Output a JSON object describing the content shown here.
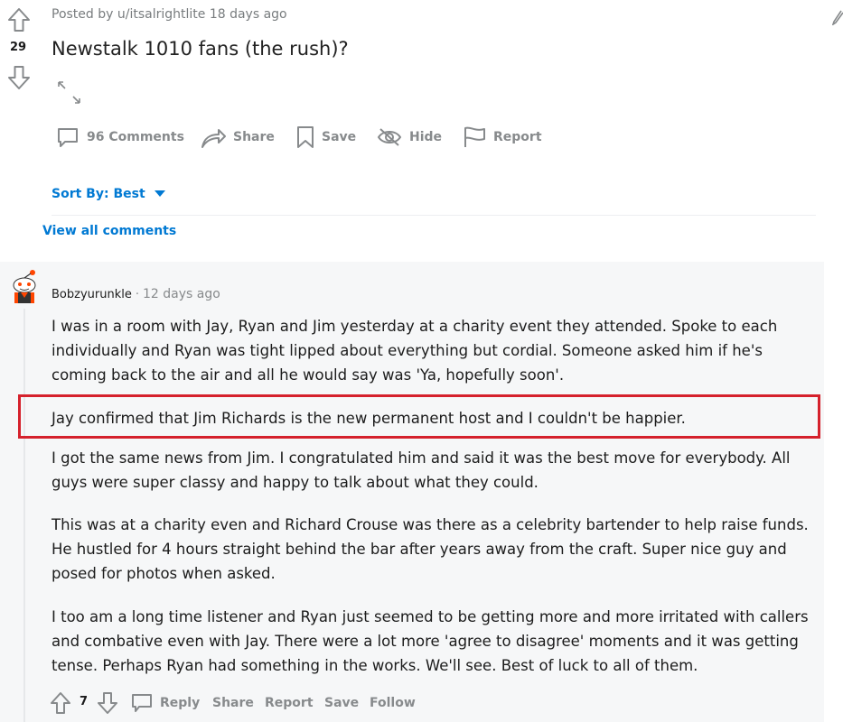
{
  "post": {
    "posted_by": "Posted by u/itsalrightlite 18 days ago",
    "score": "29",
    "title": "Newstalk 1010 fans (the rush)?",
    "actions": {
      "comments": "96 Comments",
      "share": "Share",
      "save": "Save",
      "hide": "Hide",
      "report": "Report"
    }
  },
  "sort": {
    "label": "Sort By: Best"
  },
  "view_all": "View all comments",
  "comment": {
    "author": "Bobzyurunkle",
    "separator": "·",
    "time": "12 days ago",
    "paragraphs": [
      "I was in a room with Jay, Ryan and Jim yesterday at a charity event they attended. Spoke to each individually and Ryan was tight lipped about everything but cordial. Someone asked him if he's coming back to the air and all he would say was 'Ya, hopefully soon'.",
      "Jay confirmed that Jim Richards is the new permanent host and I couldn't be happier.",
      "I got the same news from Jim. I congratulated him and said it was the best move for everybody. All guys were super classy and happy to talk about what they could.",
      "This was at a charity even and Richard Crouse was there as a celebrity bartender to help raise funds. He hustled for 4 hours straight behind the bar after years away from the craft. Super nice guy and posed for photos when asked.",
      "I too am a long time listener and Ryan just seemed to be getting more and more irritated with callers and combative even with Jay. There were a lot more 'agree to disagree' moments and it was getting tense. Perhaps Ryan had something in the works. We'll see. Best of luck to all of them."
    ],
    "score": "7",
    "actions": {
      "reply": "Reply",
      "share": "Share",
      "report": "Report",
      "save": "Save",
      "follow": "Follow"
    }
  },
  "colors": {
    "highlight": "#d5212c",
    "link_blue": "#0079d3",
    "muted": "#878a8c"
  }
}
